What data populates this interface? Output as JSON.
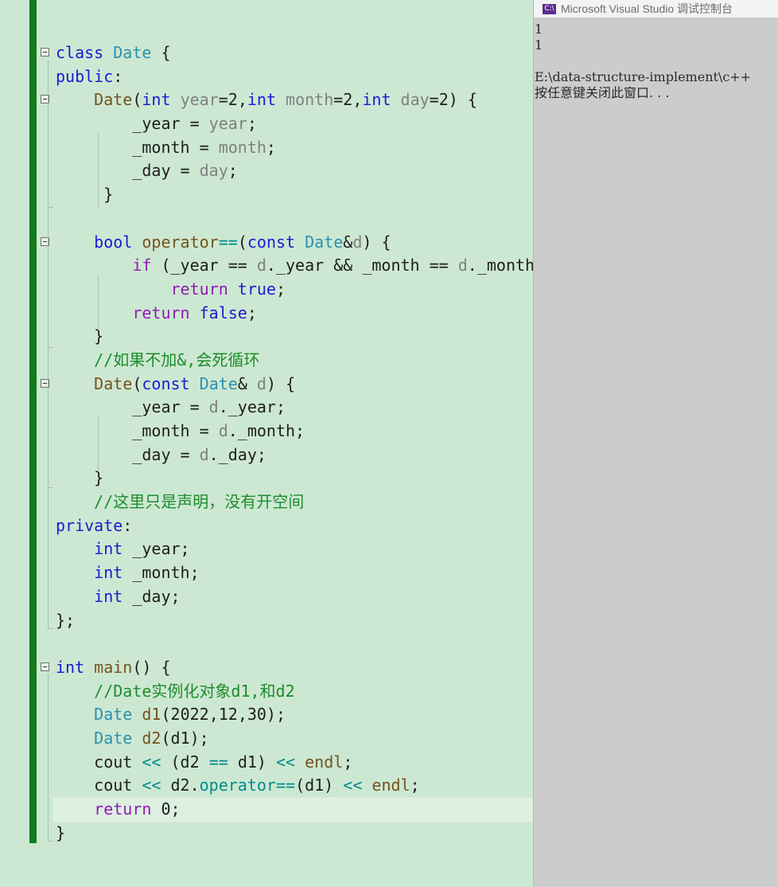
{
  "console": {
    "title": "Microsoft Visual Studio 调试控制台",
    "icon": "visual-studio-icon",
    "lines": [
      "1",
      "1",
      "",
      "E:\\data-structure-implement\\c++",
      "按任意键关闭此窗口. . ."
    ]
  },
  "editor": {
    "accent_color": "#137b1c",
    "lines": [
      {
        "fold": true,
        "tokens": [
          [
            "kw",
            "class"
          ],
          [
            "tx",
            " "
          ],
          [
            "ty",
            "Date"
          ],
          [
            "tx",
            " {"
          ]
        ]
      },
      {
        "fold": false,
        "tokens": [
          [
            "kw",
            "public"
          ],
          [
            "tx",
            ":"
          ]
        ]
      },
      {
        "fold": true,
        "tokens": [
          [
            "tx",
            "    "
          ],
          [
            "fn",
            "Date"
          ],
          [
            "tx",
            "("
          ],
          [
            "kw",
            "int"
          ],
          [
            "tx",
            " "
          ],
          [
            "pm",
            "year"
          ],
          [
            "tx",
            "=2,"
          ],
          [
            "kw",
            "int"
          ],
          [
            "tx",
            " "
          ],
          [
            "pm",
            "month"
          ],
          [
            "tx",
            "=2,"
          ],
          [
            "kw",
            "int"
          ],
          [
            "tx",
            " "
          ],
          [
            "pm",
            "day"
          ],
          [
            "tx",
            "=2) {"
          ]
        ]
      },
      {
        "fold": false,
        "tokens": [
          [
            "tx",
            "        _year = "
          ],
          [
            "pm",
            "year"
          ],
          [
            "tx",
            ";"
          ]
        ]
      },
      {
        "fold": false,
        "tokens": [
          [
            "tx",
            "        _month = "
          ],
          [
            "pm",
            "month"
          ],
          [
            "tx",
            ";"
          ]
        ]
      },
      {
        "fold": false,
        "tokens": [
          [
            "tx",
            "        _day = "
          ],
          [
            "pm",
            "day"
          ],
          [
            "tx",
            ";"
          ]
        ]
      },
      {
        "fold": false,
        "tokens": [
          [
            "tx",
            "     }"
          ]
        ]
      },
      {
        "fold": false,
        "tokens": []
      },
      {
        "fold": true,
        "tokens": [
          [
            "tx",
            "    "
          ],
          [
            "kw",
            "bool"
          ],
          [
            "tx",
            " "
          ],
          [
            "fn",
            "operator"
          ],
          [
            "op",
            "=="
          ],
          [
            "tx",
            "("
          ],
          [
            "kw",
            "const"
          ],
          [
            "tx",
            " "
          ],
          [
            "ty",
            "Date"
          ],
          [
            "tx",
            "&"
          ],
          [
            "pm",
            "d"
          ],
          [
            "tx",
            ") {"
          ]
        ]
      },
      {
        "fold": false,
        "tokens": [
          [
            "tx",
            "        "
          ],
          [
            "ctl",
            "if"
          ],
          [
            "tx",
            " (_year == "
          ],
          [
            "pm",
            "d"
          ],
          [
            "tx",
            "._year && _month == "
          ],
          [
            "pm",
            "d"
          ],
          [
            "tx",
            "._month"
          ]
        ]
      },
      {
        "fold": false,
        "tokens": [
          [
            "tx",
            "            "
          ],
          [
            "ctl",
            "return"
          ],
          [
            "tx",
            " "
          ],
          [
            "kw",
            "true"
          ],
          [
            "tx",
            ";"
          ]
        ]
      },
      {
        "fold": false,
        "tokens": [
          [
            "tx",
            "        "
          ],
          [
            "ctl",
            "return"
          ],
          [
            "tx",
            " "
          ],
          [
            "kw",
            "false"
          ],
          [
            "tx",
            ";"
          ]
        ]
      },
      {
        "fold": false,
        "tokens": [
          [
            "tx",
            "    }"
          ]
        ]
      },
      {
        "fold": false,
        "tokens": [
          [
            "cm",
            "    //如果不加&,会死循环"
          ]
        ]
      },
      {
        "fold": true,
        "tokens": [
          [
            "tx",
            "    "
          ],
          [
            "fn",
            "Date"
          ],
          [
            "tx",
            "("
          ],
          [
            "kw",
            "const"
          ],
          [
            "tx",
            " "
          ],
          [
            "ty",
            "Date"
          ],
          [
            "tx",
            "& "
          ],
          [
            "pm",
            "d"
          ],
          [
            "tx",
            ") {"
          ]
        ]
      },
      {
        "fold": false,
        "tokens": [
          [
            "tx",
            "        _year = "
          ],
          [
            "pm",
            "d"
          ],
          [
            "tx",
            "._year;"
          ]
        ]
      },
      {
        "fold": false,
        "tokens": [
          [
            "tx",
            "        _month = "
          ],
          [
            "pm",
            "d"
          ],
          [
            "tx",
            "._month;"
          ]
        ]
      },
      {
        "fold": false,
        "tokens": [
          [
            "tx",
            "        _day = "
          ],
          [
            "pm",
            "d"
          ],
          [
            "tx",
            "._day;"
          ]
        ]
      },
      {
        "fold": false,
        "tokens": [
          [
            "tx",
            "    }"
          ]
        ]
      },
      {
        "fold": false,
        "tokens": [
          [
            "cm",
            "    //这里只是声明，没有开空间"
          ]
        ]
      },
      {
        "fold": false,
        "tokens": [
          [
            "kw",
            "private"
          ],
          [
            "tx",
            ":"
          ]
        ]
      },
      {
        "fold": false,
        "tokens": [
          [
            "tx",
            "    "
          ],
          [
            "kw",
            "int"
          ],
          [
            "tx",
            " _year;"
          ]
        ]
      },
      {
        "fold": false,
        "tokens": [
          [
            "tx",
            "    "
          ],
          [
            "kw",
            "int"
          ],
          [
            "tx",
            " _month;"
          ]
        ]
      },
      {
        "fold": false,
        "tokens": [
          [
            "tx",
            "    "
          ],
          [
            "kw",
            "int"
          ],
          [
            "tx",
            " _day;"
          ]
        ]
      },
      {
        "fold": false,
        "tokens": [
          [
            "tx",
            "};"
          ]
        ]
      },
      {
        "fold": false,
        "tokens": []
      },
      {
        "fold": true,
        "tokens": [
          [
            "kw",
            "int"
          ],
          [
            "tx",
            " "
          ],
          [
            "fn",
            "main"
          ],
          [
            "tx",
            "() {"
          ]
        ]
      },
      {
        "fold": false,
        "tokens": [
          [
            "cm",
            "    //Date实例化对象d1,和d2"
          ]
        ]
      },
      {
        "fold": false,
        "tokens": [
          [
            "tx",
            "    "
          ],
          [
            "ty",
            "Date"
          ],
          [
            "tx",
            " "
          ],
          [
            "fn",
            "d1"
          ],
          [
            "tx",
            "(2022,12,30);"
          ]
        ]
      },
      {
        "fold": false,
        "tokens": [
          [
            "tx",
            "    "
          ],
          [
            "ty",
            "Date"
          ],
          [
            "tx",
            " "
          ],
          [
            "fn",
            "d2"
          ],
          [
            "tx",
            "(d1);"
          ]
        ]
      },
      {
        "fold": false,
        "tokens": [
          [
            "tx",
            "    cout "
          ],
          [
            "op",
            "<<"
          ],
          [
            "tx",
            " (d2 "
          ],
          [
            "op",
            "=="
          ],
          [
            "tx",
            " d1) "
          ],
          [
            "op",
            "<<"
          ],
          [
            "tx",
            " "
          ],
          [
            "fn",
            "endl"
          ],
          [
            "tx",
            ";"
          ]
        ]
      },
      {
        "fold": false,
        "tokens": [
          [
            "tx",
            "    cout "
          ],
          [
            "op",
            "<<"
          ],
          [
            "tx",
            " d2."
          ],
          [
            "op",
            "operator=="
          ],
          [
            "tx",
            "(d1) "
          ],
          [
            "op",
            "<<"
          ],
          [
            "tx",
            " "
          ],
          [
            "fn",
            "endl"
          ],
          [
            "tx",
            ";"
          ]
        ]
      },
      {
        "fold": false,
        "current": true,
        "tokens": [
          [
            "tx",
            "    "
          ],
          [
            "ctl",
            "return"
          ],
          [
            "tx",
            " 0;"
          ]
        ]
      },
      {
        "fold": false,
        "tokens": [
          [
            "tx",
            "}"
          ]
        ]
      }
    ]
  }
}
